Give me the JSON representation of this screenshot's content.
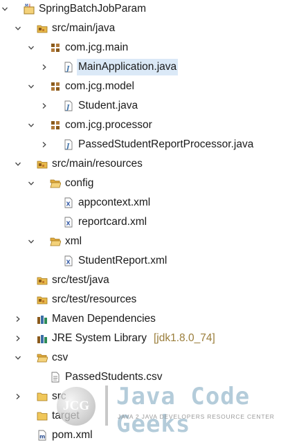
{
  "tree": {
    "project": "SpringBatchJobParam",
    "items": [
      {
        "label": "SpringBatchJobParam",
        "icon": "project-icon",
        "twisty": "expanded"
      },
      {
        "label": "src/main/java",
        "icon": "source-folder-icon",
        "twisty": "expanded"
      },
      {
        "label": "com.jcg.main",
        "icon": "package-icon",
        "twisty": "expanded"
      },
      {
        "label": "MainApplication.java",
        "icon": "java-file-icon",
        "twisty": "collapsed",
        "selected": true
      },
      {
        "label": "com.jcg.model",
        "icon": "package-icon",
        "twisty": "expanded"
      },
      {
        "label": "Student.java",
        "icon": "java-file-icon",
        "twisty": "collapsed"
      },
      {
        "label": "com.jcg.processor",
        "icon": "package-icon",
        "twisty": "expanded"
      },
      {
        "label": "PassedStudentReportProcessor.java",
        "icon": "java-file-icon",
        "twisty": "collapsed"
      },
      {
        "label": "src/main/resources",
        "icon": "source-folder-icon",
        "twisty": "expanded"
      },
      {
        "label": "config",
        "icon": "folder-open-icon",
        "twisty": "expanded"
      },
      {
        "label": "appcontext.xml",
        "icon": "xml-file-icon",
        "twisty": "none"
      },
      {
        "label": "reportcard.xml",
        "icon": "xml-file-icon",
        "twisty": "none"
      },
      {
        "label": "xml",
        "icon": "folder-open-icon",
        "twisty": "expanded"
      },
      {
        "label": "StudentReport.xml",
        "icon": "xml-file-icon",
        "twisty": "none"
      },
      {
        "label": "src/test/java",
        "icon": "source-folder-icon",
        "twisty": "none"
      },
      {
        "label": "src/test/resources",
        "icon": "source-folder-icon",
        "twisty": "none"
      },
      {
        "label": "Maven Dependencies",
        "icon": "library-icon",
        "twisty": "collapsed"
      },
      {
        "label": "JRE System Library",
        "decoration": "[jdk1.8.0_74]",
        "icon": "library-icon",
        "twisty": "collapsed"
      },
      {
        "label": "csv",
        "icon": "folder-open-icon",
        "twisty": "expanded"
      },
      {
        "label": "PassedStudents.csv",
        "icon": "text-file-icon",
        "twisty": "none"
      },
      {
        "label": "src",
        "icon": "folder-icon",
        "twisty": "collapsed"
      },
      {
        "label": "target",
        "icon": "folder-icon",
        "twisty": "none"
      },
      {
        "label": "pom.xml",
        "icon": "maven-pom-icon",
        "twisty": "none"
      }
    ]
  },
  "watermark": {
    "logo_text": "JCG",
    "title": "Java Code Geeks",
    "subtitle": "JAVA 2 JAVA DEVELOPERS RESOURCE CENTER"
  },
  "colors": {
    "selection": "#dbe9f7",
    "decoration": "#9a7d3a",
    "package": "#8a5a1c",
    "folder": "#e7b84a"
  }
}
